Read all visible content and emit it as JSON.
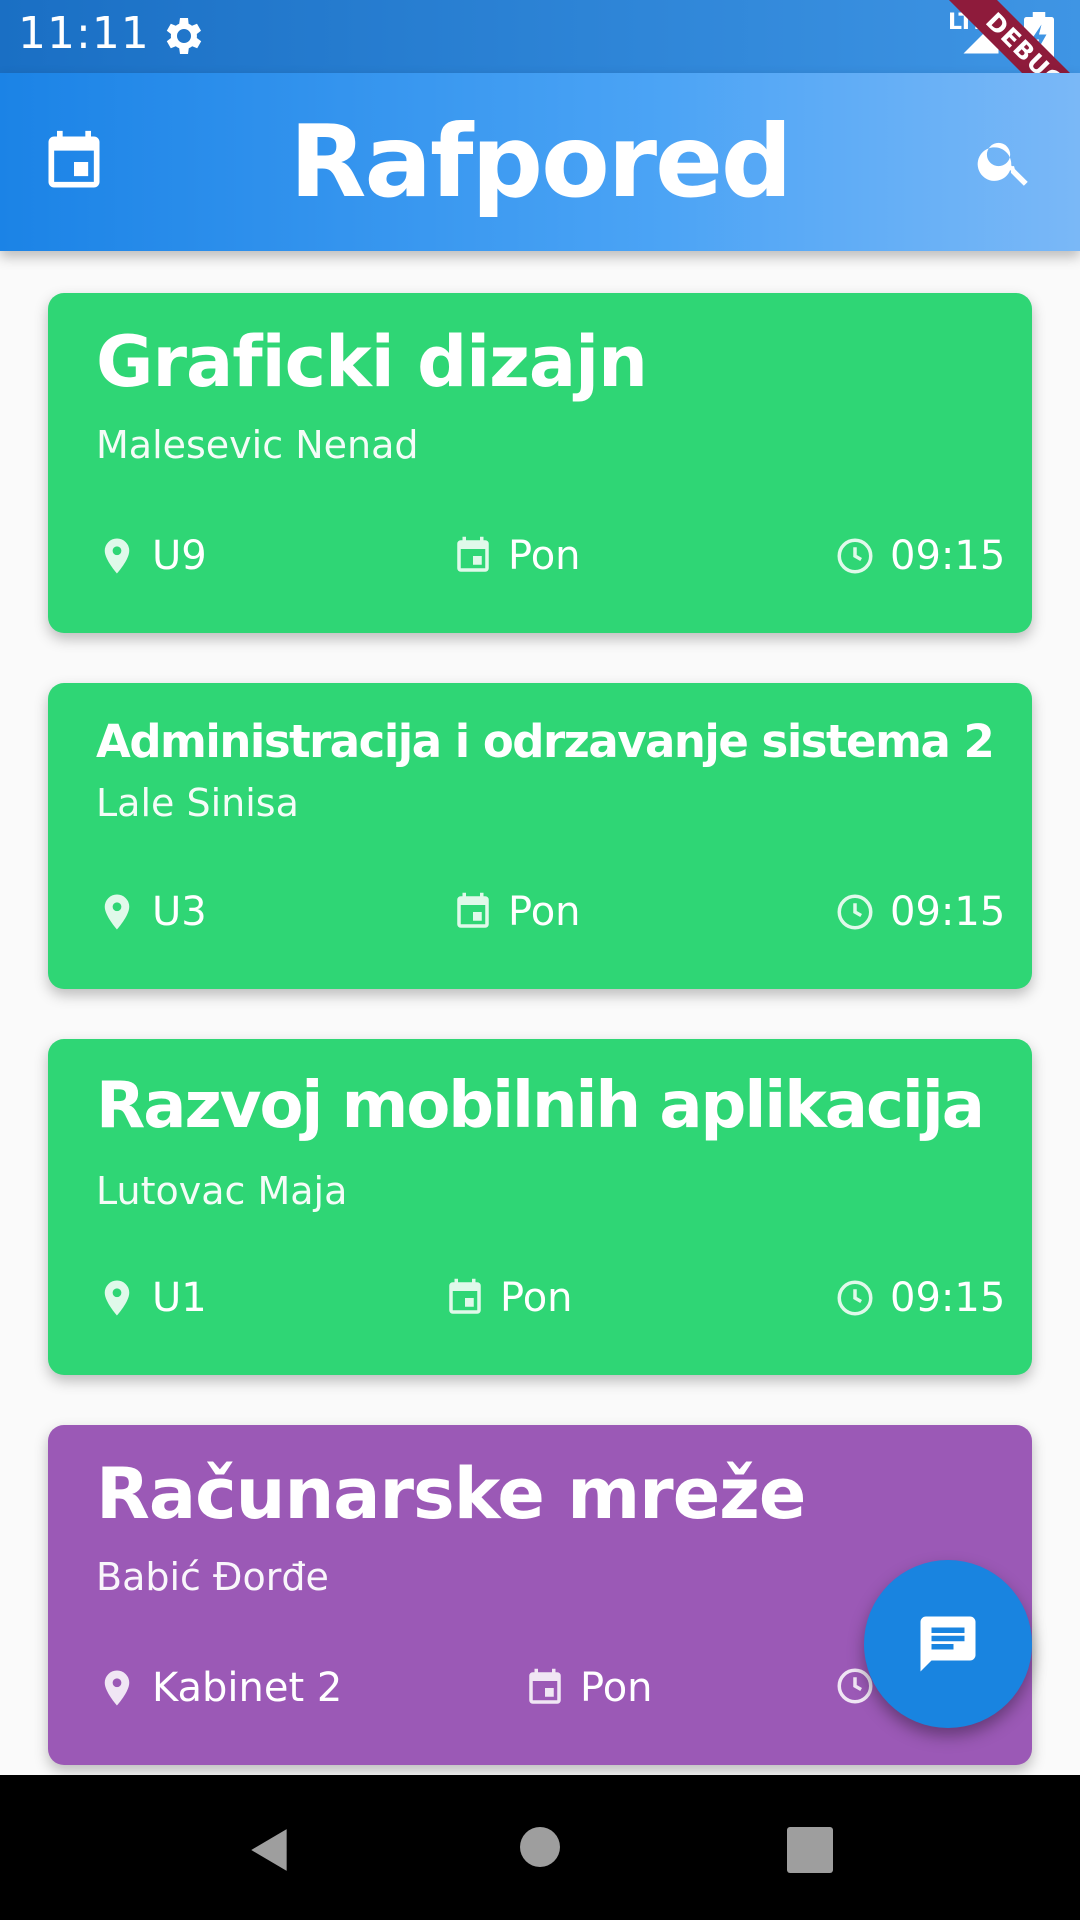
{
  "status_bar": {
    "time": "11:11",
    "network": "LTE"
  },
  "debug_banner": "DEBUG",
  "app_bar": {
    "title": "Rafpored"
  },
  "colors": {
    "green_card": "#2fd675",
    "purple_card": "#9b59b6",
    "fab": "#1984e0"
  },
  "cards": [
    {
      "title": "Graficki dizajn",
      "professor": "Malesevic Nenad",
      "room": "U9",
      "day": "Pon",
      "time": "09:15"
    },
    {
      "title": "Administracija i odrzavanje sistema 2",
      "professor": "Lale Sinisa",
      "room": "U3",
      "day": "Pon",
      "time": "09:15"
    },
    {
      "title": "Razvoj mobilnih aplikacija",
      "professor": "Lutovac Maja",
      "room": "U1",
      "day": "Pon",
      "time": "09:15"
    },
    {
      "title": "Računarske mreže",
      "professor": "Babić Đorđe",
      "room": "Kabinet 2",
      "day": "Pon",
      "time": ""
    }
  ],
  "icons": {
    "status": [
      "gear-icon",
      "signal-icon",
      "battery-icon"
    ],
    "app_bar": [
      "calendar-icon",
      "search-icon"
    ],
    "card_meta": [
      "location-pin-icon",
      "calendar-icon",
      "clock-icon"
    ],
    "fab": "message-icon",
    "nav": [
      "back-icon",
      "home-icon",
      "recents-icon"
    ]
  }
}
